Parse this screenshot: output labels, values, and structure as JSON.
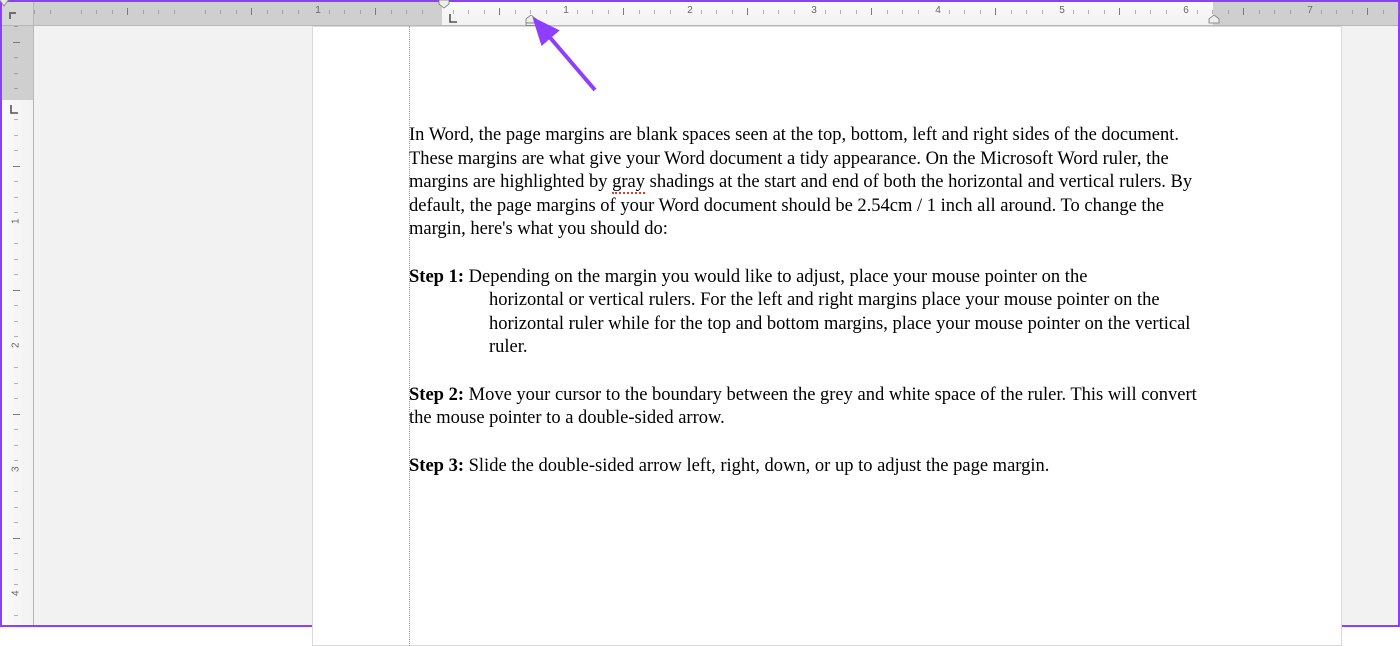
{
  "ruler": {
    "h_numbers": [
      "1",
      "1",
      "2",
      "3",
      "4",
      "5",
      "6",
      "7"
    ],
    "v_numbers": [
      "1",
      "2",
      "3",
      "4"
    ]
  },
  "doc": {
    "intro": "In Word, the page margins are blank spaces seen at the top, bottom, left and right sides of the document. These margins are what give your Word document a tidy appearance. On the Microsoft Word ruler, the margins are highlighted by ",
    "intro_squiggle": "gray",
    "intro_tail": " shadings at the start and end of both the horizontal and vertical rulers. By default, the page margins of your Word document should be 2.54cm / 1 inch all around. To change the margin, here's what you should do:",
    "step1_label": "Step 1:",
    "step1_first": " Depending on the margin you would like to adjust, place your mouse pointer on the",
    "step1_rest": "horizontal or vertical rulers. For the left and right margins place your mouse pointer on the horizontal ruler while for the top and bottom margins, place your mouse pointer on the vertical ruler.",
    "step2_label": "Step 2:",
    "step2_text": " Move your cursor to the boundary between the grey and white space of the ruler. This will convert the mouse pointer to a double-sided arrow.",
    "step3_label": "Step 3:",
    "step3_text": " Slide the double-sided arrow left, right, down, or up to adjust the page margin."
  },
  "annotation": {
    "color": "#8f3eff"
  }
}
